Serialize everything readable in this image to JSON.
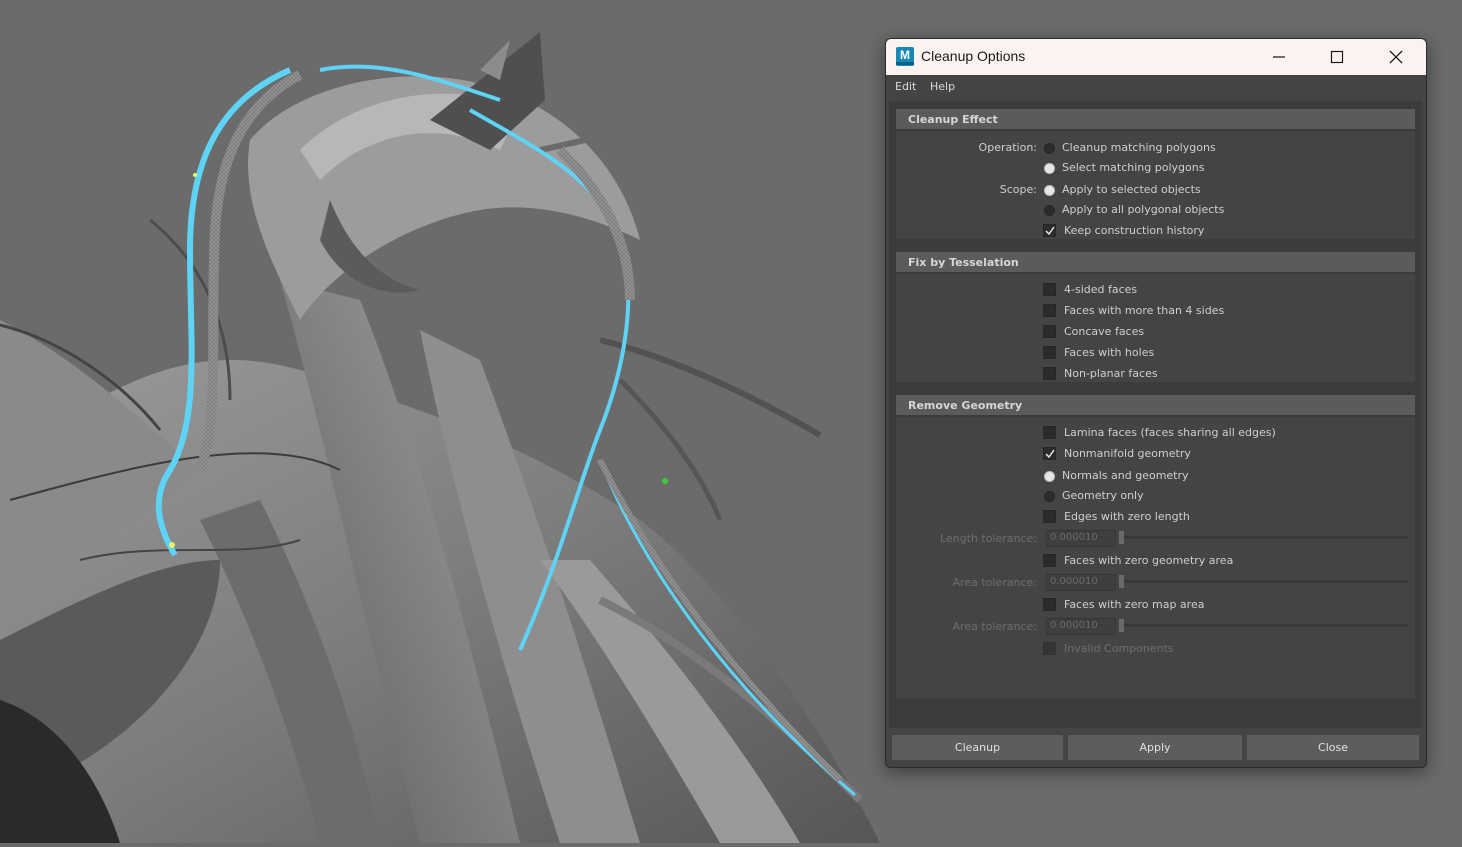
{
  "dialog": {
    "title": "Cleanup Options",
    "app_icon_letter": "M",
    "window_controls": [
      "minimize-icon",
      "maximize-icon",
      "close-icon"
    ]
  },
  "menu": {
    "edit": "Edit",
    "help": "Help"
  },
  "cleanup_effect": {
    "header": "Cleanup Effect",
    "operation_label": "Operation:",
    "op_cleanup": "Cleanup matching polygons",
    "op_select": "Select matching polygons",
    "operation_selected": "Select matching polygons",
    "scope_label": "Scope:",
    "scope_selected_objects": "Apply to selected objects",
    "scope_all_objects": "Apply to all polygonal objects",
    "scope_selected": "Apply to selected objects",
    "keep_history": "Keep construction history",
    "keep_history_checked": true
  },
  "tesselation": {
    "header": "Fix by Tesselation",
    "four_sided": "4-sided faces",
    "more_than_four": "Faces with more than 4 sides",
    "concave": "Concave faces",
    "holes": "Faces with holes",
    "non_planar": "Non-planar faces"
  },
  "remove_geometry": {
    "header": "Remove Geometry",
    "lamina": "Lamina faces (faces sharing all edges)",
    "nonmanifold": "Nonmanifold geometry",
    "nonmanifold_checked": true,
    "normals_and_geometry": "Normals and geometry",
    "geometry_only": "Geometry only",
    "nonmanifold_mode_selected": "Normals and geometry",
    "edges_zero_length": "Edges with zero length",
    "length_tolerance_label": "Length tolerance:",
    "length_tolerance_value": "0.000010",
    "faces_zero_geom_area": "Faces with zero geometry area",
    "area_tolerance_label": "Area tolerance:",
    "area_tolerance_value": "0.000010",
    "faces_zero_map_area": "Faces with zero map area",
    "map_area_tolerance_label": "Area tolerance:",
    "map_area_tolerance_value": "0.000010",
    "invalid_components": "Invalid Components"
  },
  "buttons": {
    "cleanup": "Cleanup",
    "apply": "Apply",
    "close": "Close"
  },
  "colors": {
    "viewport_bg": "#6b6b6b",
    "selection_highlight": "#5fd3f5",
    "dialog_bg": "#444444",
    "titlebar_bg": "#fbf3ef"
  }
}
